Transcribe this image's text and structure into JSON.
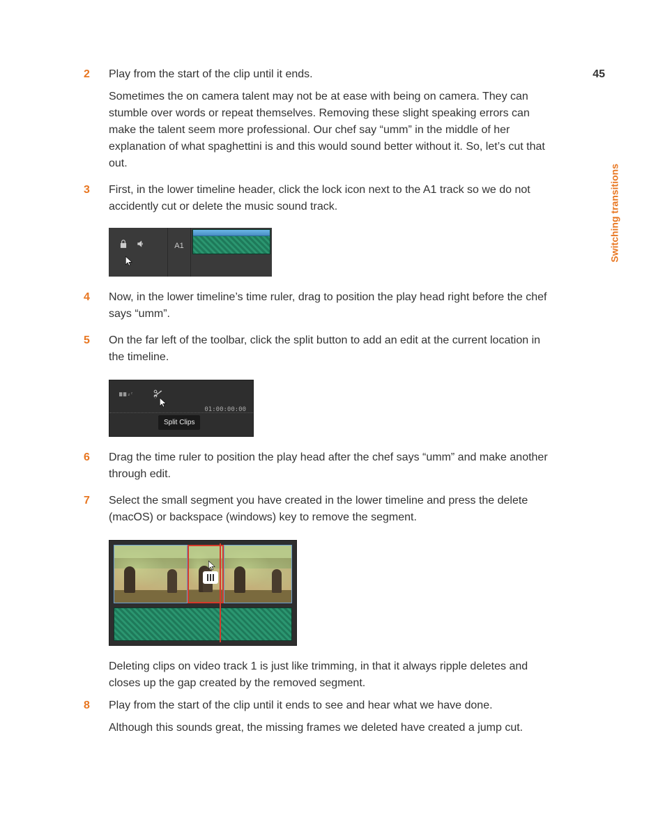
{
  "page_number": "45",
  "side_label": "Switching transitions",
  "steps": {
    "s2": {
      "num": "2",
      "line1": "Play from the start of the clip until it ends.",
      "line2": "Sometimes the on camera talent may not be at ease with being on camera. They can stumble over words or repeat themselves. Removing these slight speaking errors can make the talent seem more professional. Our chef say “umm” in the middle of her explanation of what spaghettini is and this would sound better without it. So, let’s cut that out."
    },
    "s3": {
      "num": "3",
      "line1": "First, in the lower timeline header, click the lock icon next to the A1 track so we do not accidently cut or delete the music sound track."
    },
    "s4": {
      "num": "4",
      "line1": "Now, in the lower timeline’s time ruler, drag to position the play head right before the chef says “umm”."
    },
    "s5": {
      "num": "5",
      "line1": "On the far left of the toolbar, click the split button to add an edit at the current location in the timeline."
    },
    "s6": {
      "num": "6",
      "line1": "Drag the time ruler to position the play head after the chef says “umm” and make another through edit."
    },
    "s7": {
      "num": "7",
      "line1": "Select the small segment you have created in the lower timeline and press the delete (macOS) or backspace (windows) key to remove the segment."
    },
    "s8": {
      "num": "8",
      "line1": "Play from the start of the clip until it ends to see and hear what we have done.",
      "line2": "Although this sounds great, the missing frames we deleted have created a jump cut."
    },
    "after7": "Deleting clips on video track 1 is just like trimming, in that it always ripple deletes and closes up the gap created by the removed segment."
  },
  "fig1": {
    "track_label": "A1"
  },
  "fig2": {
    "tooltip": "Split Clips",
    "timecode": "01:00:00:00"
  }
}
